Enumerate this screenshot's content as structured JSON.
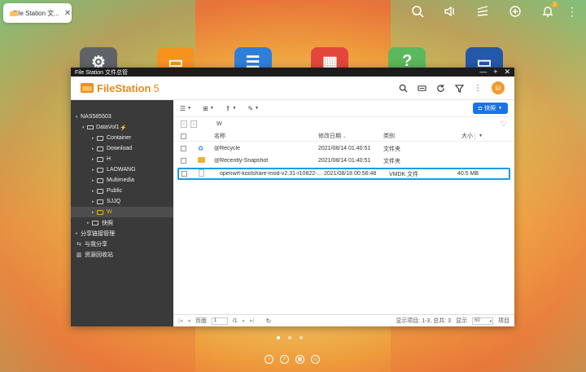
{
  "taskbar": {
    "tab_title": "File Station 文...",
    "tab_close": "✕",
    "notif_count": "2",
    "more": "⋮"
  },
  "window": {
    "title": "File Station 文件总管",
    "min": "—",
    "max": "+",
    "close": "✕"
  },
  "app": {
    "brand": "FileStation",
    "version": "5",
    "avatar": "⛁"
  },
  "sidebar": {
    "nas": "NAS585503",
    "volume": "DataVol1",
    "folders": [
      "Container",
      "Download",
      "H",
      "LAOWANG",
      "Multimedia",
      "Public",
      "SJJQ",
      "W"
    ],
    "active": "W",
    "snapshot": "快照",
    "share_mgmt": "分享链接管理",
    "shared_with_me": "与我分享",
    "recycle_bin": "资源回收站"
  },
  "toolbar": {
    "quick_label": "快照"
  },
  "path": {
    "current": "W"
  },
  "table": {
    "headers": {
      "name": "名称",
      "date": "修改日期",
      "type": "类别",
      "size": "大小"
    },
    "rows": [
      {
        "name": "@Recycle",
        "date": "2021/08/14 01:40:51",
        "type": "文件夹",
        "size": ""
      },
      {
        "name": "@Recently-Snapshot",
        "date": "2021/08/14 01:40:51",
        "type": "文件夹",
        "size": ""
      },
      {
        "name": "openwrt-koolshare-mod-v2.31-r10822-50...",
        "date": "2021/08/18 00:56:48",
        "type": "VMDK 文件",
        "size": "40.5 MB"
      }
    ]
  },
  "footer": {
    "page_label": "页面",
    "page_value": "1",
    "page_total": "/1",
    "display_info": "显示项目: 1-3, 总共: 3",
    "display_label": "显示",
    "per_page": "50",
    "items_label": "项目"
  },
  "colors": {
    "accent": "#1e9be6",
    "brand": "#e98a1b"
  }
}
